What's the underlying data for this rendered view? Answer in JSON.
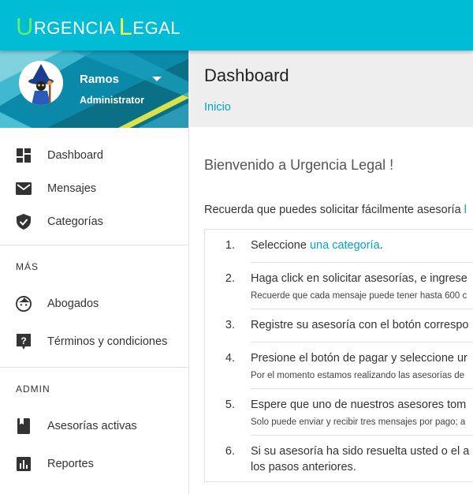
{
  "app": {
    "logo": {
      "word1_initial": "U",
      "word1_rest": "RGENCIA",
      "word2_initial": "L",
      "word2_rest": "EGAL"
    },
    "colors": {
      "topbar": "#00bcd4",
      "accent_green": "#5ff06b",
      "accent_yellow": "#f2f04a",
      "link": "#00a5c8"
    }
  },
  "user": {
    "name": "Ramos",
    "role": "Administrator"
  },
  "sidebar": {
    "main_items": [
      {
        "label": "Dashboard",
        "icon": "dashboard-icon"
      },
      {
        "label": "Mensajes",
        "icon": "mail-icon"
      },
      {
        "label": "Categorías",
        "icon": "shield-check-icon"
      }
    ],
    "section_more": "MÁS",
    "more_items": [
      {
        "label": "Abogados",
        "icon": "face-icon"
      },
      {
        "label": "Términos y condiciones",
        "icon": "help-icon"
      }
    ],
    "section_admin": "ADMIN",
    "admin_items": [
      {
        "label": "Asesorías activas",
        "icon": "book-icon"
      },
      {
        "label": "Reportes",
        "icon": "bar-chart-icon"
      }
    ]
  },
  "header": {
    "title": "Dashboard",
    "breadcrumb": "Inicio"
  },
  "content": {
    "welcome": "Bienvenido a Urgencia Legal !",
    "intro": "Recuerda que puedes solicitar fácilmente asesoría ",
    "intro_link": "l",
    "steps": [
      {
        "num": "1.",
        "text": "Seleccione ",
        "link": "una categoría",
        "text_after": "."
      },
      {
        "num": "2.",
        "text": "Haga click en solicitar asesorías, e ingrese",
        "note": "Recuerde que cada mensaje puede tener hasta 600 c"
      },
      {
        "num": "3.",
        "text": "Registre su asesoría con el botón correspo"
      },
      {
        "num": "4.",
        "text": "Presione el botón de pagar y seleccione ur",
        "note": "Por el momento estamos realizando las asesorías de"
      },
      {
        "num": "5.",
        "text": "Espere que uno de nuestros asesores tom",
        "note": "Solo puede enviar y recibir tres mensajes por pago; a"
      },
      {
        "num": "6.",
        "text": "Si su asesoría ha sido resuelta usted o el a",
        "text2": "los pasos anteriores."
      }
    ]
  }
}
